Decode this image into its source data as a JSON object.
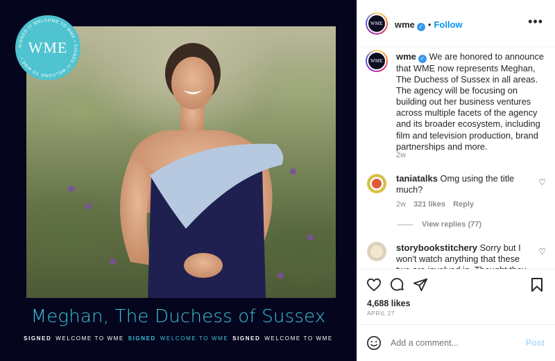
{
  "media": {
    "badge_logo": "WME",
    "badge_ring": "SIGNED /// WELCOME TO WME • SIGNED /// WELCOME TO WME •",
    "title": "Meghan, The Duchess of Sussex",
    "strip": [
      {
        "text": "SIGNED",
        "style": "bold"
      },
      {
        "text": "WELCOME TO WME",
        "style": "plain"
      },
      {
        "text": "SIGNED",
        "style": "bold-accent"
      },
      {
        "text": "WELCOME TO WME",
        "style": "plain"
      },
      {
        "text": "SIGNED",
        "style": "bold"
      },
      {
        "text": "WELCOME TO WME",
        "style": "plain"
      }
    ],
    "colors": {
      "background": "#05051d",
      "accent": "#39c5dc",
      "badge": "#4fc3cf"
    }
  },
  "header": {
    "username": "wme",
    "separator": "•",
    "follow_label": "Follow",
    "more_icon": "more-horizontal-icon"
  },
  "caption": {
    "username": "wme",
    "text": "We are honored to announce that WME now represents Meghan, The Duchess of Sussex in all areas. The agency will be focusing on building out her business ventures across multiple facets of the agency and its broader ecosystem, including film and television production, brand partnerships and more.",
    "time": "2w"
  },
  "comments": [
    {
      "username": "taniatalks",
      "text": "Omg using the title much?",
      "time": "2w",
      "likes": "321 likes",
      "reply_label": "Reply",
      "view_replies": "View replies (77)"
    },
    {
      "username": "storybookstitchery",
      "text": "Sorry but I won't watch anything that these two are involved in. Thought they wanted"
    }
  ],
  "actions": {
    "icons": [
      "heart-icon",
      "comment-icon",
      "share-icon",
      "bookmark-icon"
    ],
    "likes": "4,688 likes",
    "date": "APRIL 27"
  },
  "add_comment": {
    "placeholder": "Add a comment...",
    "post_label": "Post",
    "emoji_icon": "emoji-icon"
  },
  "colors": {
    "link": "#0095f6",
    "verified": "#3897f0",
    "muted": "#8e8e8e",
    "post_disabled": "#b3dbff"
  }
}
